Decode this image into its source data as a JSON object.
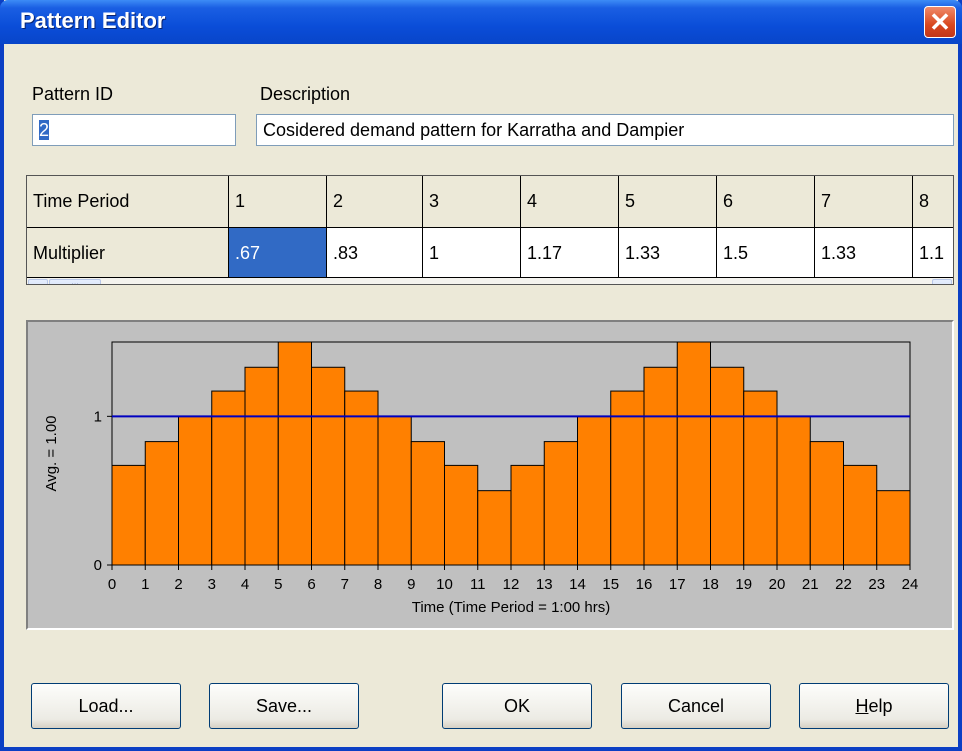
{
  "window": {
    "title": "Pattern Editor",
    "close_glyph": "✕"
  },
  "pattern_id": {
    "label": "Pattern ID",
    "value": "2"
  },
  "description": {
    "label": "Description",
    "value": "Cosidered demand pattern for Karratha and Dampier"
  },
  "grid": {
    "row_labels": [
      "Time Period",
      "Multiplier"
    ],
    "periods": [
      "1",
      "2",
      "3",
      "4",
      "5",
      "6",
      "7",
      "8"
    ],
    "multipliers": [
      ".67",
      ".83",
      "1",
      "1.17",
      "1.33",
      "1.5",
      "1.33",
      "1.1"
    ],
    "selected_index": 0
  },
  "scrollbar": {
    "left_arrow": "◀",
    "right_arrow": "▶",
    "thumb_grip": "|||"
  },
  "chart_data": {
    "type": "bar",
    "x": [
      "0",
      "1",
      "2",
      "3",
      "4",
      "5",
      "6",
      "7",
      "8",
      "9",
      "10",
      "11",
      "12",
      "13",
      "14",
      "15",
      "16",
      "17",
      "18",
      "19",
      "20",
      "21",
      "22",
      "23",
      "24"
    ],
    "values": [
      0.67,
      0.83,
      1,
      1.17,
      1.33,
      1.5,
      1.33,
      1.17,
      1,
      0.83,
      0.67,
      0.5,
      0.67,
      0.83,
      1,
      1.17,
      1.33,
      1.5,
      1.33,
      1.17,
      1,
      0.83,
      0.67,
      0.5
    ],
    "average": 1.0,
    "xlabel": "Time (Time Period = 1:00 hrs)",
    "ylabel": "Avg. = 1.00",
    "yticks": [
      "0",
      "1"
    ],
    "ylim": [
      0,
      1.5
    ],
    "colors": {
      "bar": "#ff8000",
      "average_line": "#0000c0",
      "plot_bg": "#c0c0c0"
    }
  },
  "buttons": {
    "load": "Load...",
    "save": "Save...",
    "ok": "OK",
    "cancel": "Cancel",
    "help_underlined": "H",
    "help_rest": "elp"
  }
}
